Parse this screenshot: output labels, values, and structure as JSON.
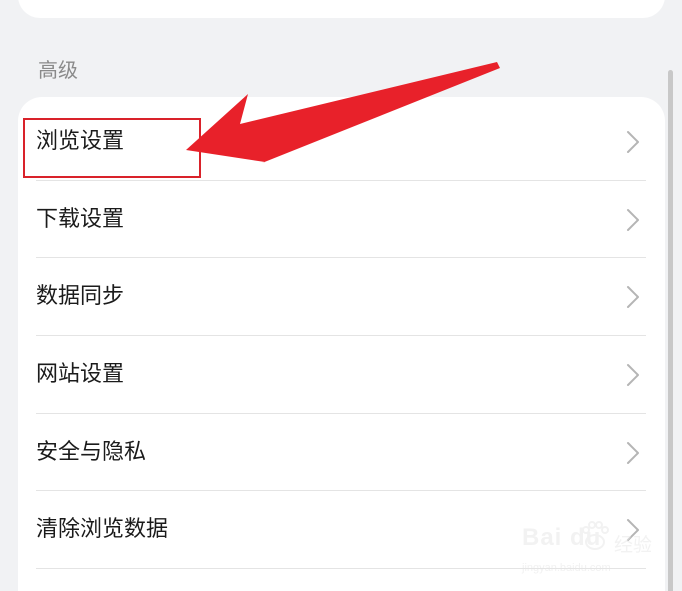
{
  "section": {
    "title": "高级"
  },
  "settings": {
    "items": [
      {
        "label": "浏览设置"
      },
      {
        "label": "下载设置"
      },
      {
        "label": "数据同步"
      },
      {
        "label": "网站设置"
      },
      {
        "label": "安全与隐私"
      },
      {
        "label": "清除浏览数据"
      }
    ]
  },
  "annotation": {
    "box_color": "#d9222a",
    "arrow_color": "#e8212a"
  },
  "watermark": {
    "brand": "Bai du",
    "jingyan": "经验",
    "url": "jingyan.baidu.com"
  },
  "icons": {
    "chevron": "chevron-right-icon",
    "paw": "baidu-paw-icon"
  }
}
